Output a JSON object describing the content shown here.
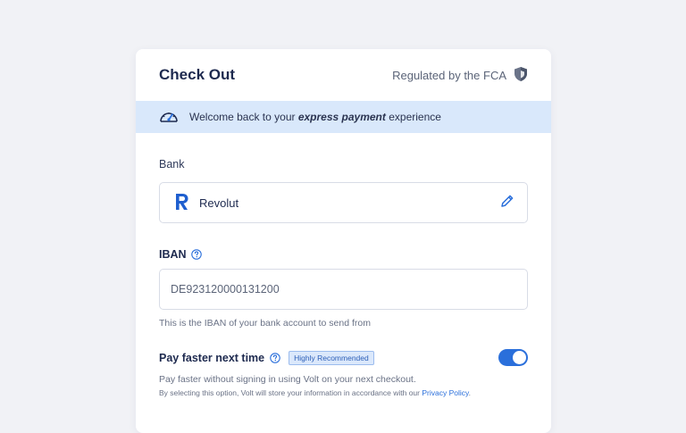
{
  "header": {
    "title": "Check Out",
    "regulated_label": "Regulated by the FCA"
  },
  "banner": {
    "prefix": "Welcome back to your ",
    "highlight": "express payment",
    "suffix": " experience"
  },
  "bank": {
    "label": "Bank",
    "name": "Revolut"
  },
  "iban": {
    "label": "IBAN",
    "value": "DE923120000131200",
    "hint": "This is the IBAN of your bank account to send from"
  },
  "pay_faster": {
    "label": "Pay faster next time",
    "badge": "Highly Recommended",
    "enabled": true,
    "description": "Pay faster without signing in using Volt on your next checkout.",
    "consent_prefix": "By selecting this option, Volt will store your information in accordance with our ",
    "privacy_link": "Privacy Policy",
    "consent_suffix": "."
  },
  "colors": {
    "accent": "#2a6fdb",
    "banner_bg": "#d9e8fb",
    "title": "#1e2a4f"
  },
  "icons": [
    "shield-icon",
    "speedometer-icon",
    "revolut-logo-icon",
    "pencil-icon",
    "help-icon"
  ]
}
